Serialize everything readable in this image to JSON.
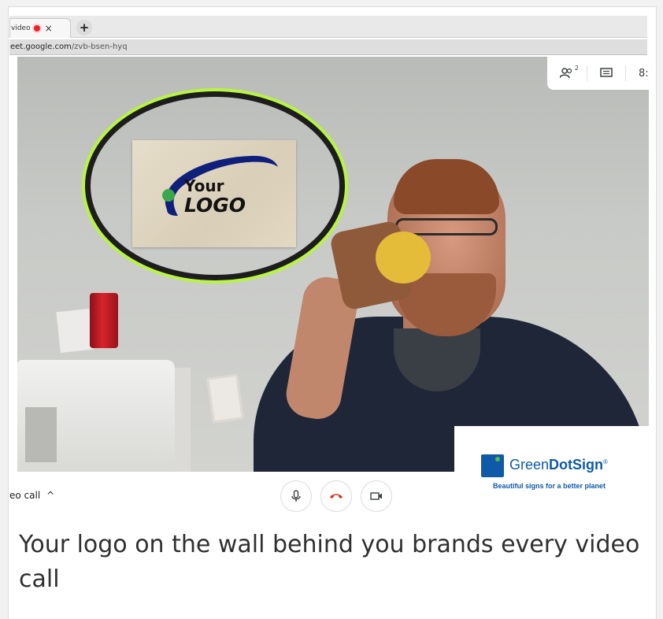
{
  "browser": {
    "tab_title": "video",
    "tab_close": "×",
    "new_tab": "+",
    "url_host": "eet.google.com",
    "url_path": "/zvb-bsen-hyq"
  },
  "meet": {
    "people_count": "2",
    "time_partial": "8:",
    "meeting_label": "eo call",
    "meeting_caret": "^"
  },
  "logo_sign": {
    "line1": "Your",
    "line2": "LOGO",
    "colors": {
      "swoosh": "#0f1f7a",
      "dot": "#3aa84a",
      "ring_outer": "#b7f540",
      "ring_inner": "#1d1d1d"
    }
  },
  "ad": {
    "brand_light": "Green",
    "brand_bold": "DotSign",
    "registered": "®",
    "tagline": "Beautiful signs for a better planet",
    "colors": {
      "blue": "#0f5aa8",
      "green": "#4bbe45"
    }
  },
  "caption": "Your logo on the wall behind you brands every video call"
}
